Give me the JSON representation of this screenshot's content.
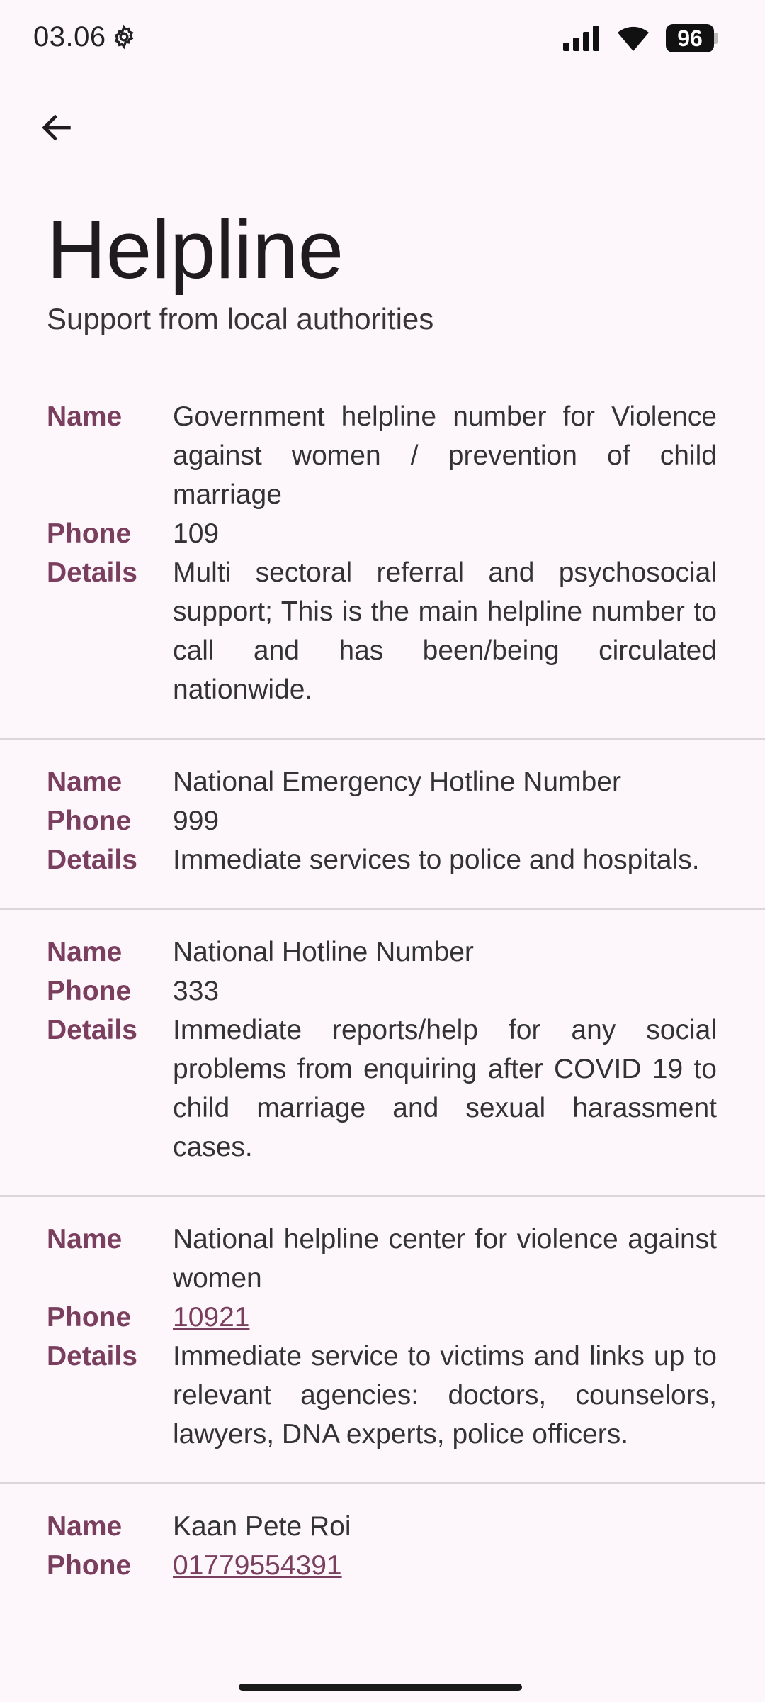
{
  "status_bar": {
    "time": "03.06",
    "battery": "96"
  },
  "header": {
    "title": "Helpline",
    "subtitle": "Support from local authorities"
  },
  "labels": {
    "name": "Name",
    "phone": "Phone",
    "details": "Details"
  },
  "entries": [
    {
      "name": "Government helpline number for Violence against women / prevention of child marriage",
      "phone": "109",
      "details": "Multi sectoral referral and psychosocial support; This is the main helpline number to call and has been/being circulated nationwide."
    },
    {
      "name": "National Emergency Hotline Number",
      "phone": "999",
      "details": "Immediate services to police and hospitals."
    },
    {
      "name": "National Hotline Number",
      "phone": "333",
      "details": "Immediate reports/help for any social problems from enquiring after COVID 19 to child marriage and sexual harassment cases."
    },
    {
      "name": "National helpline center for violence against women",
      "phone": "10921",
      "details": "Immediate service to victims and links up to relevant agencies: doctors, counselors, lawyers, DNA experts, police officers."
    },
    {
      "name": "Kaan Pete Roi",
      "phone": "01779554391"
    }
  ]
}
